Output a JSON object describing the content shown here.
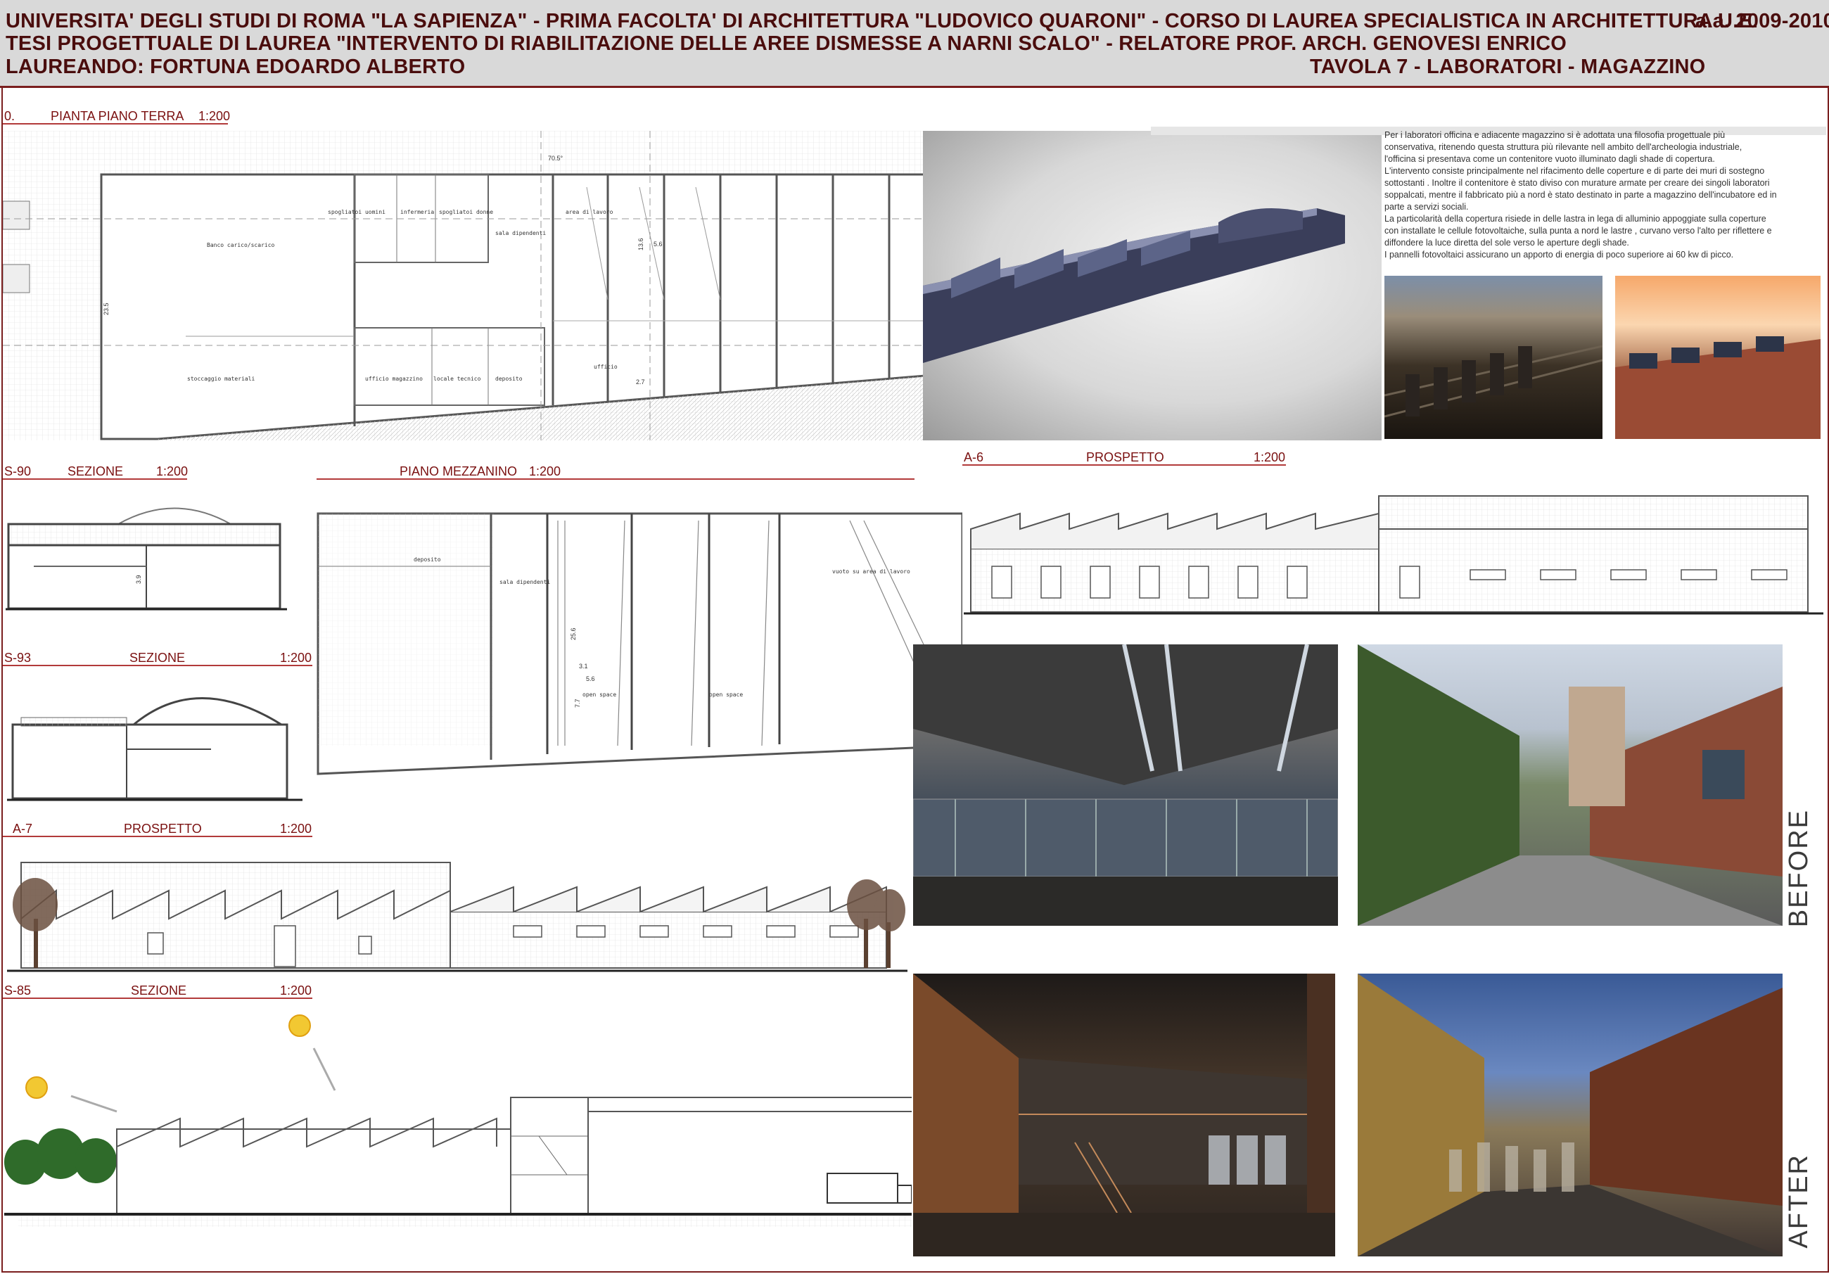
{
  "header": {
    "line1": "UNIVERSITA' DEGLI STUDI DI ROMA \"LA SAPIENZA\" - PRIMA FACOLTA' DI ARCHITETTURA \"LUDOVICO QUARONI\" - CORSO DI LAUREA SPECIALISTICA IN ARCHITETTURA U.E.",
    "year": "a.a. 2009-2010",
    "line2": "TESI PROGETTUALE DI LAUREA   \"INTERVENTO DI RIABILITAZIONE DELLE AREE DISMESSE A NARNI SCALO\" - RELATORE PROF. ARCH. GENOVESI ENRICO",
    "line3": "LAUREANDO: FORTUNA EDOARDO ALBERTO",
    "tavola": "TAVOLA 7 - LABORATORI - MAGAZZINO"
  },
  "labels": {
    "pianta_code": "0.",
    "pianta_title": "PIANTA PIANO TERRA",
    "pianta_scale": "1:200",
    "s90_code": "S-90",
    "s90_title": "SEZIONE",
    "s90_scale": "1:200",
    "mezz_title": "PIANO MEZZANINO",
    "mezz_scale": "1:200",
    "a6_code": "A-6",
    "a6_title": "PROSPETTO",
    "a6_scale": "1:200",
    "s93_code": "S-93",
    "s93_title": "SEZIONE",
    "s93_scale": "1:200",
    "a7_code": "A-7",
    "a7_title": "PROSPETTO",
    "a7_scale": "1:200",
    "s85_code": "S-85",
    "s85_title": "SEZIONE",
    "s85_scale": "1:200",
    "before": "BEFORE",
    "after": "AFTER"
  },
  "plan_rooms": {
    "r1": "Banco carico/scarico",
    "r2": "stoccaggio materiali",
    "r3": "ufficio magazzino",
    "r4": "locale tecnico",
    "r5": "deposito",
    "r6": "area di lavoro",
    "r7": "spogliatoi uomini",
    "r8": "spogliatoi donne",
    "r9": "infermeria",
    "r10": "sala dipendenti",
    "r11": "ufficio",
    "r12": "open space",
    "r13": "vuoto su area di lavoro"
  },
  "dims": {
    "d1": "70.5°",
    "d2": "23.5",
    "d3": "13.6",
    "d4": "5.6",
    "d5": "2.7",
    "d6": "25.6",
    "d7": "3.1",
    "d8": "7.7",
    "d9": "3.9",
    "d10": "5.6"
  },
  "description": [
    "Per i laboratori officina e adiacente magazzino si è adottata una filosofia progettuale più conservativa, ritenendo questa struttura più rilevante nell ambito dell'archeologia industriale,",
    "l'officina si presentava come un contenitore vuoto illuminato dagli shade di copertura.",
    "L'intervento consiste principalmente nel rifacimento delle coperture e  di parte dei muri di sostegno sottostanti . Inoltre il contenitore è stato diviso con murature armate  per creare dei singoli laboratori soppalcati, mentre il fabbricato più a nord è stato destinato in parte a magazzino dell'incubatore ed in parte a servizi sociali.",
    "La particolarità della copertura risiede in delle lastra in lega di alluminio appoggiate sulla coperture con installate le cellule fotovoltaiche, sulla punta a nord le lastre , curvano verso l'alto per riflettere e diffondere la luce diretta del sole verso le aperture degli shade.",
    "I pannelli fotovoltaici assicurano un apporto di energia di poco superiore ai 60 kw di picco."
  ],
  "colors": {
    "accent": "#7a1e1e",
    "header_bg": "#d9d9d9",
    "title_text": "#4a0d0d"
  }
}
